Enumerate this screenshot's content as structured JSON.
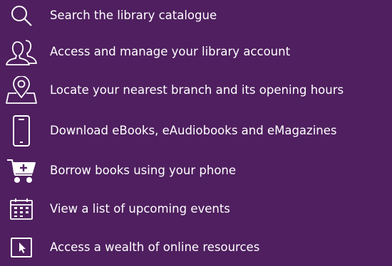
{
  "features": [
    {
      "icon": "search-icon",
      "label": "Search the library catalogue"
    },
    {
      "icon": "people-icon",
      "label": "Access and manage your library account"
    },
    {
      "icon": "location-pin-icon",
      "label": "Locate your nearest branch and its opening hours"
    },
    {
      "icon": "smartphone-icon",
      "label": "Download eBooks, eAudiobooks and eMagazines"
    },
    {
      "icon": "shopping-cart-icon",
      "label": "Borrow books using your phone"
    },
    {
      "icon": "calendar-icon",
      "label": "View a list of upcoming events"
    },
    {
      "icon": "cursor-window-icon",
      "label": "Access a wealth of online resources"
    }
  ],
  "colors": {
    "background": "#4f1f5f",
    "foreground": "#ffffff"
  }
}
